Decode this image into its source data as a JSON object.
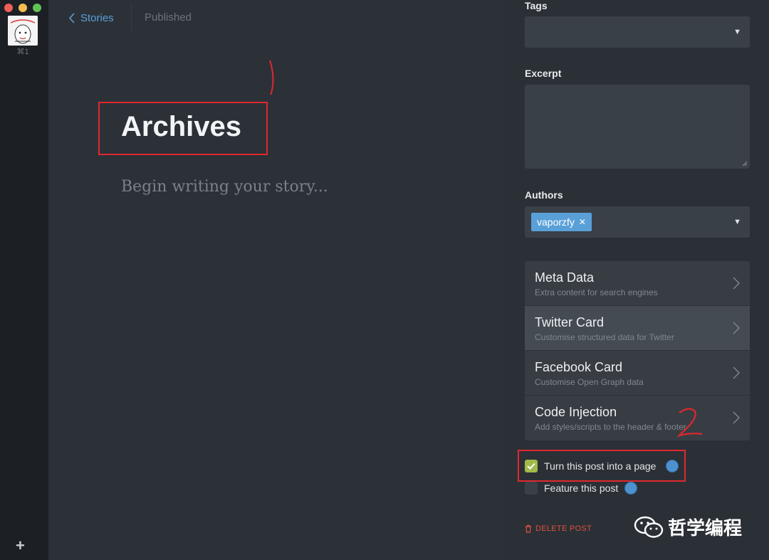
{
  "sidebar": {
    "shortcut": "⌘1",
    "add_icon": "plus-icon"
  },
  "header": {
    "back_label": "Stories",
    "status": "Published"
  },
  "editor": {
    "title": "Archives",
    "body_placeholder": "Begin writing your story..."
  },
  "settings": {
    "tags": {
      "label": "Tags",
      "value": ""
    },
    "excerpt": {
      "label": "Excerpt",
      "value": ""
    },
    "authors": {
      "label": "Authors",
      "selected": [
        "vaporzfy"
      ]
    },
    "menu": [
      {
        "title": "Meta Data",
        "subtitle": "Extra content for search engines",
        "active": false
      },
      {
        "title": "Twitter Card",
        "subtitle": "Customise structured data for Twitter",
        "active": true
      },
      {
        "title": "Facebook Card",
        "subtitle": "Customise Open Graph data",
        "active": false
      },
      {
        "title": "Code Injection",
        "subtitle": "Add styles/scripts to the header & footer",
        "active": false
      }
    ],
    "checkboxes": [
      {
        "label": "Turn this post into a page",
        "checked": true
      },
      {
        "label": "Feature this post",
        "checked": false
      }
    ],
    "delete_label": "DELETE POST"
  },
  "watermark": {
    "text": "哲学编程"
  },
  "colors": {
    "accent": "#5aa0d8",
    "check": "#9fbb4a",
    "danger": "#e0503f",
    "annotation": "#e0282e"
  }
}
